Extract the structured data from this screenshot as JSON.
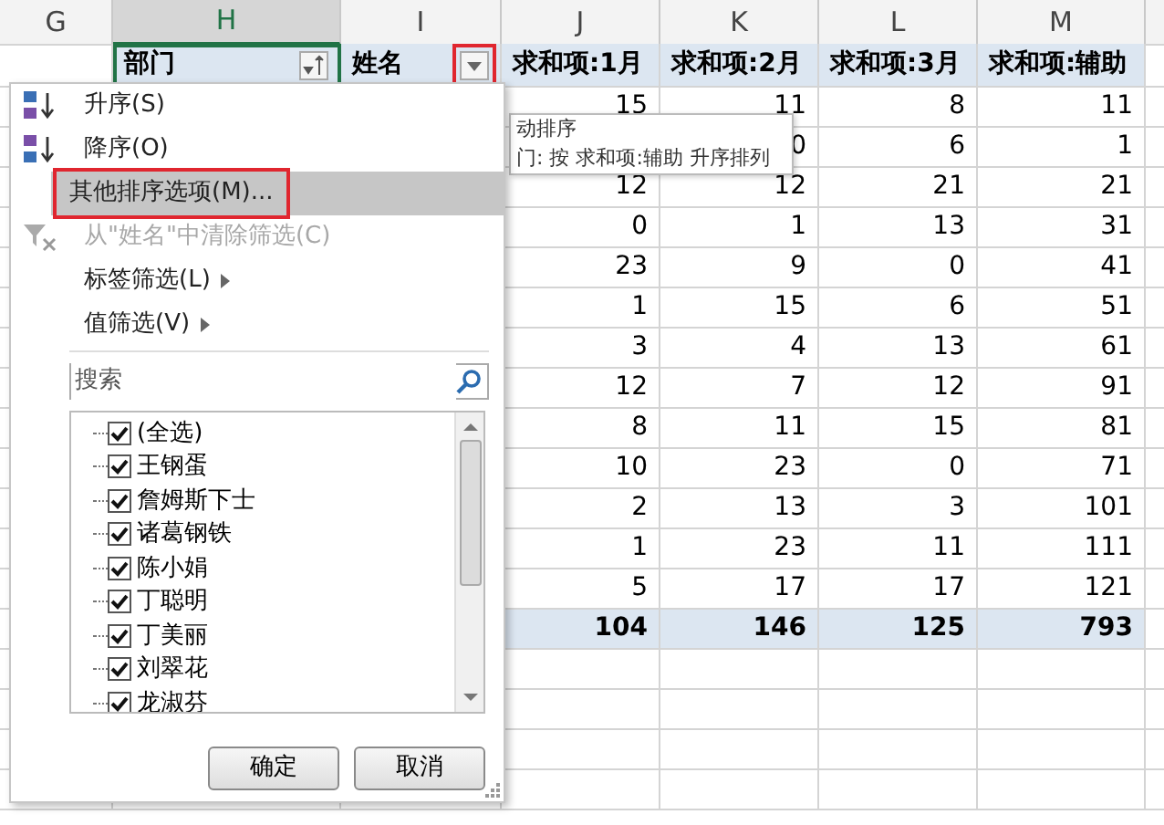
{
  "column_headers": [
    {
      "label": "G",
      "selected": false
    },
    {
      "label": "H",
      "selected": true
    },
    {
      "label": "I",
      "selected": false
    },
    {
      "label": "J",
      "selected": false
    },
    {
      "label": "K",
      "selected": false
    },
    {
      "label": "L",
      "selected": false
    },
    {
      "label": "M",
      "selected": false
    }
  ],
  "pivot": {
    "headers": [
      {
        "label": "部门",
        "kind": "sort",
        "annotated": false
      },
      {
        "label": "姓名",
        "kind": "filter",
        "annotated": true
      },
      {
        "label": "求和项:1月"
      },
      {
        "label": "求和项:2月"
      },
      {
        "label": "求和项:3月"
      },
      {
        "label": "求和项:辅助"
      }
    ],
    "rows": [
      [
        "15",
        "11",
        "8",
        "11"
      ],
      [
        null,
        "0",
        "6",
        "1"
      ],
      [
        "12",
        "12",
        "21",
        "21"
      ],
      [
        "0",
        "1",
        "13",
        "31"
      ],
      [
        "23",
        "9",
        "0",
        "41"
      ],
      [
        "1",
        "15",
        "6",
        "51"
      ],
      [
        "3",
        "4",
        "13",
        "61"
      ],
      [
        "12",
        "7",
        "12",
        "91"
      ],
      [
        "8",
        "11",
        "15",
        "81"
      ],
      [
        "10",
        "23",
        "0",
        "71"
      ],
      [
        "2",
        "13",
        "3",
        "101"
      ],
      [
        "1",
        "23",
        "11",
        "111"
      ],
      [
        "5",
        "17",
        "17",
        "121"
      ]
    ],
    "total": [
      "104",
      "146",
      "125",
      "793"
    ]
  },
  "tooltip": {
    "title": "动排序",
    "text": "门: 按 求和项:辅助 升序排列"
  },
  "menu": {
    "items": [
      {
        "label": "升序(S)",
        "kind": "sort-asc",
        "disabled": false,
        "highlighted": false,
        "annotated": false
      },
      {
        "label": "降序(O)",
        "kind": "sort-desc",
        "disabled": false,
        "highlighted": false,
        "annotated": false
      },
      {
        "label": "其他排序选项(M)...",
        "kind": "plain",
        "disabled": false,
        "highlighted": true,
        "annotated": true
      },
      {
        "label": "从\"姓名\"中清除筛选(C)",
        "kind": "clear-filter",
        "disabled": true,
        "highlighted": false,
        "annotated": false
      },
      {
        "label": "标签筛选(L)",
        "kind": "submenu",
        "disabled": false,
        "highlighted": false,
        "annotated": false
      },
      {
        "label": "值筛选(V)",
        "kind": "submenu",
        "disabled": false,
        "highlighted": false,
        "annotated": false
      }
    ],
    "search": {
      "placeholder": "搜索"
    },
    "list": [
      {
        "label": "(全选)",
        "checked": true
      },
      {
        "label": "王钢蛋",
        "checked": true
      },
      {
        "label": "詹姆斯下士",
        "checked": true
      },
      {
        "label": "诸葛钢铁",
        "checked": true
      },
      {
        "label": "陈小娟",
        "checked": true
      },
      {
        "label": "丁聪明",
        "checked": true
      },
      {
        "label": "丁美丽",
        "checked": true
      },
      {
        "label": "刘翠花",
        "checked": true
      },
      {
        "label": "龙淑芬",
        "checked": true
      }
    ],
    "buttons": [
      "确定",
      "取消"
    ]
  }
}
